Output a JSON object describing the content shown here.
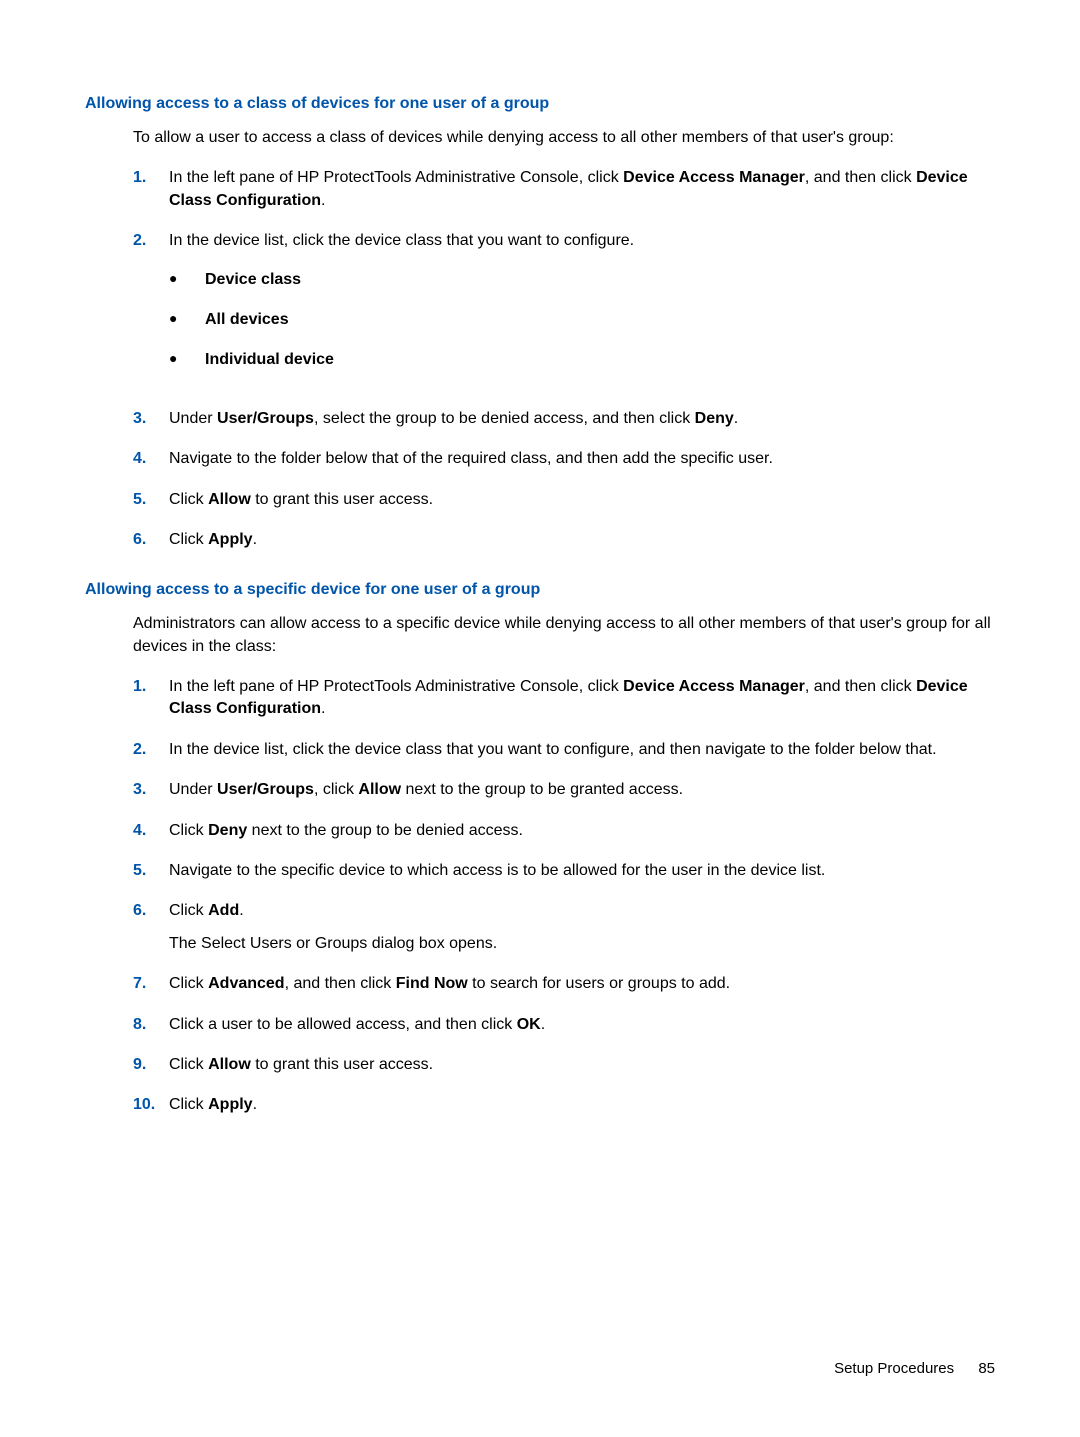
{
  "section1": {
    "heading": "Allowing access to a class of devices for one user of a group",
    "intro": "To allow a user to access a class of devices while denying access to all other members of that user's group:",
    "step1_pre": "In the left pane of HP ProtectTools Administrative Console, click ",
    "step1_bold1": "Device Access Manager",
    "step1_mid": ", and then click ",
    "step1_bold2": "Device Class Configuration",
    "step1_end": ".",
    "step2": "In the device list, click the device class that you want to configure.",
    "bullet1": "Device class",
    "bullet2": "All devices",
    "bullet3": "Individual device",
    "step3_pre": "Under ",
    "step3_bold1": "User/Groups",
    "step3_mid": ", select the group to be denied access, and then click ",
    "step3_bold2": "Deny",
    "step3_end": ".",
    "step4": "Navigate to the folder below that of the required class, and then add the specific user.",
    "step5_pre": "Click ",
    "step5_bold": "Allow",
    "step5_end": " to grant this user access.",
    "step6_pre": "Click ",
    "step6_bold": "Apply",
    "step6_end": "."
  },
  "section2": {
    "heading": "Allowing access to a specific device for one user of a group",
    "intro": "Administrators can allow access to a specific device while denying access to all other members of that user's group for all devices in the class:",
    "step1_pre": "In the left pane of HP ProtectTools Administrative Console, click ",
    "step1_bold1": "Device Access Manager",
    "step1_mid": ", and then click ",
    "step1_bold2": "Device Class Configuration",
    "step1_end": ".",
    "step2": "In the device list, click the device class that you want to configure, and then navigate to the folder below that.",
    "step3_pre": "Under ",
    "step3_bold1": "User/Groups",
    "step3_mid": ", click ",
    "step3_bold2": "Allow",
    "step3_end": " next to the group to be granted access.",
    "step4_pre": "Click ",
    "step4_bold": "Deny",
    "step4_end": " next to the group to be denied access.",
    "step5": "Navigate to the specific device to which access is to be allowed for the user in the device list.",
    "step6_pre": "Click ",
    "step6_bold": "Add",
    "step6_end": ".",
    "step6_sub": "The Select Users or Groups dialog box opens.",
    "step7_pre": "Click ",
    "step7_bold1": "Advanced",
    "step7_mid": ", and then click ",
    "step7_bold2": "Find Now",
    "step7_end": " to search for users or groups to add.",
    "step8_pre": "Click a user to be allowed access, and then click ",
    "step8_bold": "OK",
    "step8_end": ".",
    "step9_pre": "Click ",
    "step9_bold": "Allow",
    "step9_end": " to grant this user access.",
    "step10_pre": "Click ",
    "step10_bold": "Apply",
    "step10_end": "."
  },
  "nums": {
    "n1": "1.",
    "n2": "2.",
    "n3": "3.",
    "n4": "4.",
    "n5": "5.",
    "n6": "6.",
    "n7": "7.",
    "n8": "8.",
    "n9": "9.",
    "n10": "10."
  },
  "bullet_char": "●",
  "footer": {
    "text": "Setup Procedures",
    "page": "85"
  }
}
